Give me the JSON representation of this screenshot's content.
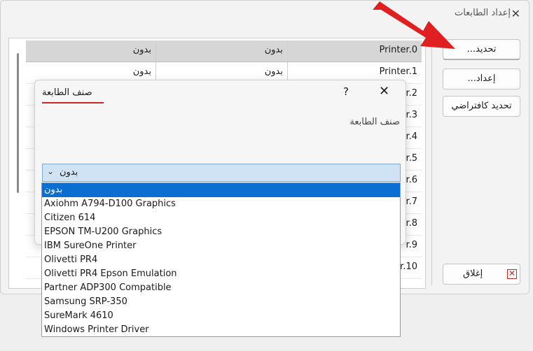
{
  "window": {
    "title": "إعداد الطابعات"
  },
  "table": {
    "columns_visible": [
      "",
      "",
      ""
    ],
    "rows": [
      {
        "name": "Printer.0",
        "c2": "بدون",
        "c3": "بدون"
      },
      {
        "name": "Printer.1",
        "c2": "بدون",
        "c3": "بدون"
      },
      {
        "name": "r.2",
        "c2": "",
        "c3": ""
      },
      {
        "name": "r.3",
        "c2": "",
        "c3": ""
      },
      {
        "name": "r.4",
        "c2": "",
        "c3": ""
      },
      {
        "name": "r.5",
        "c2": "",
        "c3": ""
      },
      {
        "name": "r.6",
        "c2": "",
        "c3": ""
      },
      {
        "name": "r.7",
        "c2": "",
        "c3": ""
      },
      {
        "name": "r.8",
        "c2": "",
        "c3": ""
      },
      {
        "name": "r.9",
        "c2": "",
        "c3": ""
      },
      {
        "name": "r.10",
        "c2": "",
        "c3": ""
      }
    ]
  },
  "buttons": {
    "select": "تحديد...",
    "setup": "إعداد...",
    "set_default": "تحديد كافتراضي",
    "close": "إغلاق"
  },
  "dialog": {
    "tab": "صنف الطابعة",
    "help": "?",
    "label": "صنف الطابعة",
    "combo_value": "بدون",
    "options": [
      "بدون",
      "Axiohm A794-D100 Graphics",
      "Citizen 614",
      "EPSON TM-U200 Graphics",
      "IBM SureOne Printer",
      "Olivetti PR4",
      "Olivetti PR4 Epson Emulation",
      "Partner ADP300 Compatible",
      "Samsung SRP-350",
      "SureMark 4610",
      "Windows Printer Driver"
    ],
    "selected_index": 0
  },
  "colors": {
    "accent": "#c62828",
    "selection": "#0b6fd1",
    "combo_bg": "#cfe3f5",
    "arrow": "#e02020"
  }
}
